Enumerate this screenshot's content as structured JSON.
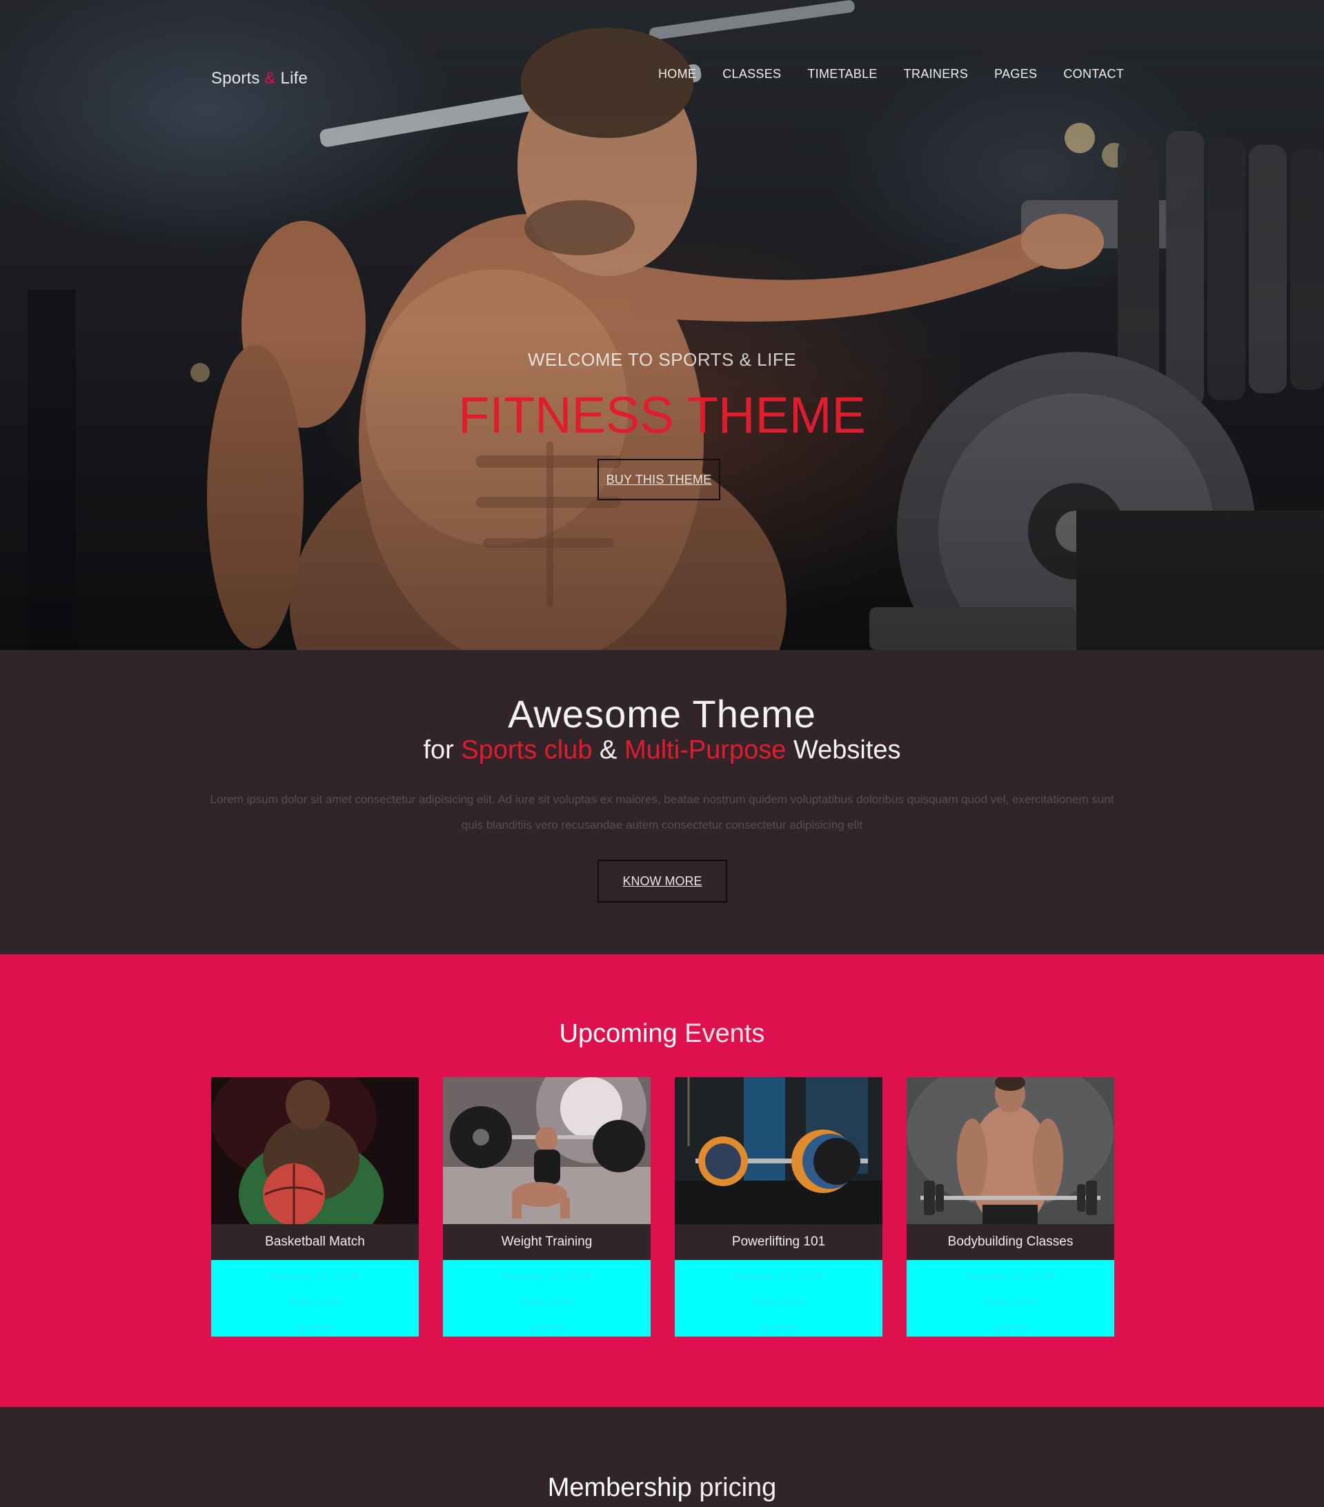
{
  "brand": {
    "name_part1": "Sports",
    "amp": "&",
    "name_part2": "Life",
    "accent": "#e0114b"
  },
  "nav": {
    "items": [
      {
        "label": "HOME"
      },
      {
        "label": "CLASSES"
      },
      {
        "label": "TIMETABLE"
      },
      {
        "label": "TRAINERS"
      },
      {
        "label": "PAGES"
      },
      {
        "label": "CONTACT"
      }
    ]
  },
  "hero": {
    "subtitle": "WELCOME TO SPORTS & LIFE",
    "title": "FITNESS THEME",
    "button": "BUY THIS THEME",
    "title_color": "#e01d2e"
  },
  "about": {
    "title": "Awesome Theme",
    "sub_for": "for",
    "sub_hl1": "Sports club",
    "sub_amp": "&",
    "sub_hl2": "Multi-Purpose",
    "sub_end": "Websites",
    "text": "Lorem ipsum dolor sit amet consectetur adipisicing elit. Ad iure sit voluptas ex maiores, beatae nostrum quidem voluptatibus doloribus quisquam quod vel, exercitationem sunt quis blanditiis vero recusandae autem consectetur consectetur adipisicing elit",
    "button": "KNOW MORE"
  },
  "events": {
    "title_bold": "Upcoming",
    "title_light": "Events",
    "bg_color": "#de104d",
    "info_color": "#00ffff",
    "cards": [
      {
        "name": "Basketball Match",
        "date": "february 10, 2014",
        "time": "9:00-11:00",
        "trainer": "cj jones"
      },
      {
        "name": "Weight Training",
        "date": "february 10, 2014",
        "time": "9:00-11:00",
        "trainer": "cj jones"
      },
      {
        "name": "Powerlifting 101",
        "date": "february 10, 2014",
        "time": "9:00-11:00",
        "trainer": "cj jones"
      },
      {
        "name": "Bodybuilding Classes",
        "date": "february 10, 2014",
        "time": "9:00-11:00",
        "trainer": "cj jones"
      }
    ]
  },
  "pricing": {
    "title_bold": "Membership",
    "title_light": "pricing"
  }
}
